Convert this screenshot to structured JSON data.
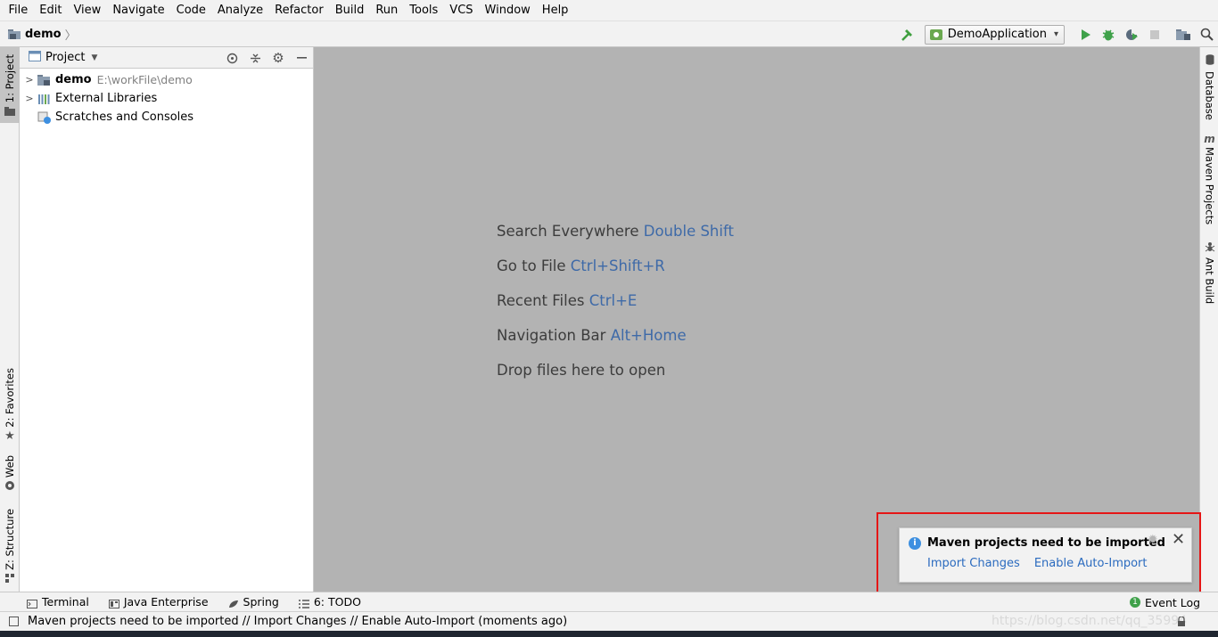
{
  "menu": [
    "File",
    "Edit",
    "View",
    "Navigate",
    "Code",
    "Analyze",
    "Refactor",
    "Build",
    "Run",
    "Tools",
    "VCS",
    "Window",
    "Help"
  ],
  "breadcrumb": {
    "project": "demo"
  },
  "toolbar": {
    "run_config": "DemoApplication",
    "icons": [
      "build-hammer-icon",
      "run-icon",
      "debug-icon",
      "run-with-coverage-icon",
      "stop-icon",
      "project-structure-icon",
      "search-everywhere-icon"
    ]
  },
  "left_stripe": {
    "project": "1: Project",
    "favorites": "2: Favorites",
    "web": "Web",
    "structure": "Z: Structure"
  },
  "right_stripe": {
    "database": "Database",
    "maven": "Maven Projects",
    "ant": "Ant Build"
  },
  "project_panel": {
    "title": "Project",
    "tree": [
      {
        "label": "demo",
        "path": "E:\\workFile\\demo",
        "expandable": true
      },
      {
        "label": "External Libraries",
        "path": "",
        "expandable": true
      },
      {
        "label": "Scratches and Consoles",
        "path": "",
        "expandable": false
      }
    ]
  },
  "editor_hints": [
    {
      "text": "Search Everywhere",
      "key": "Double Shift"
    },
    {
      "text": "Go to File",
      "key": "Ctrl+Shift+R"
    },
    {
      "text": "Recent Files",
      "key": "Ctrl+E"
    },
    {
      "text": "Navigation Bar",
      "key": "Alt+Home"
    },
    {
      "text": "Drop files here to open",
      "key": ""
    }
  ],
  "notification": {
    "title": "Maven projects need to be imported",
    "link_import": "Import Changes",
    "link_auto": "Enable Auto-Import",
    "highlight_color": "#e51616"
  },
  "bottom_tools": {
    "terminal": "Terminal",
    "java_enterprise": "Java Enterprise",
    "spring": "Spring",
    "todo": "6: TODO",
    "event_log": "Event Log",
    "event_count": "1"
  },
  "status": {
    "message": "Maven projects need to be imported // Import Changes // Enable Auto-Import (moments ago)",
    "watermark": "https://blog.csdn.net/qq_35994"
  },
  "colors": {
    "editor_bg": "#b3b3b3",
    "link_blue": "#2b6bbf",
    "hint_key": "#3e6aa8",
    "run_green": "#3fa14a"
  }
}
